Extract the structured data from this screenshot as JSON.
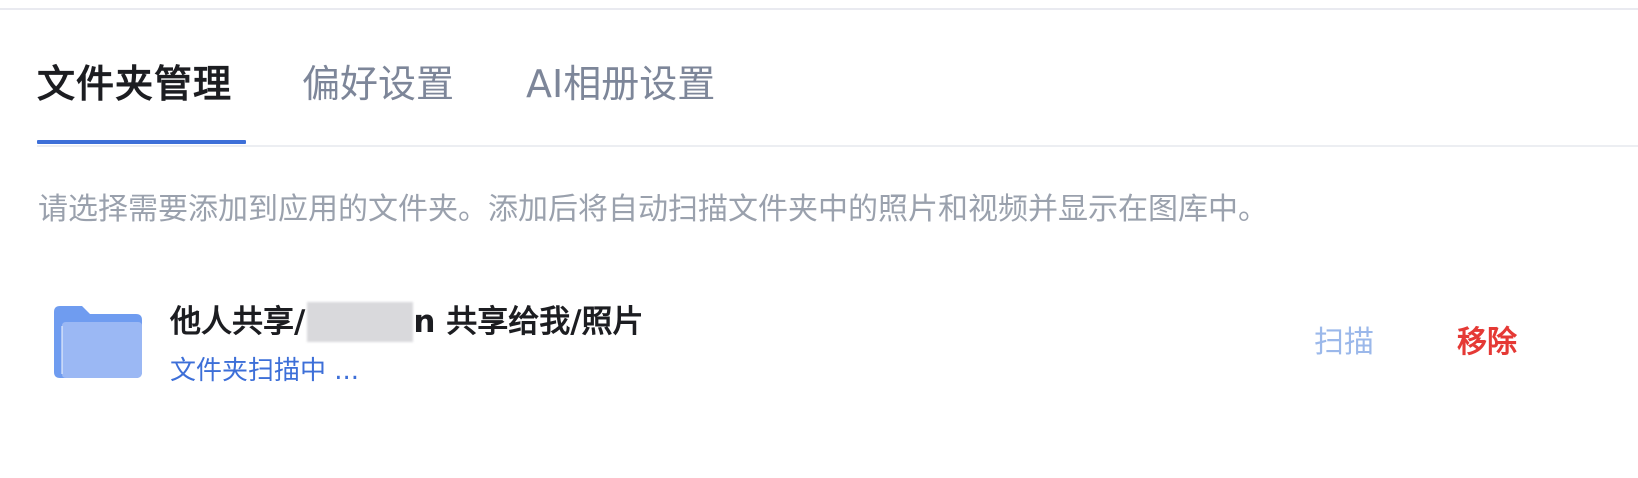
{
  "tabs": {
    "folder_management": "文件夹管理",
    "preferences": "偏好设置",
    "ai_album_settings": "AI相册设置",
    "active": "folder_management"
  },
  "description": "请选择需要添加到应用的文件夹。添加后将自动扫描文件夹中的照片和视频并显示在图库中。",
  "folder": {
    "path_prefix": "他人共享/",
    "path_suffix": "n 共享给我/照片",
    "status": "文件夹扫描中 ...",
    "icon": "folder-icon",
    "scan_label": "扫描",
    "remove_label": "移除"
  },
  "colors": {
    "accent": "#3d6fd8",
    "scan_button": "#9bb8ea",
    "remove_button": "#e53935",
    "folder_icon": "#6f9cf0"
  }
}
